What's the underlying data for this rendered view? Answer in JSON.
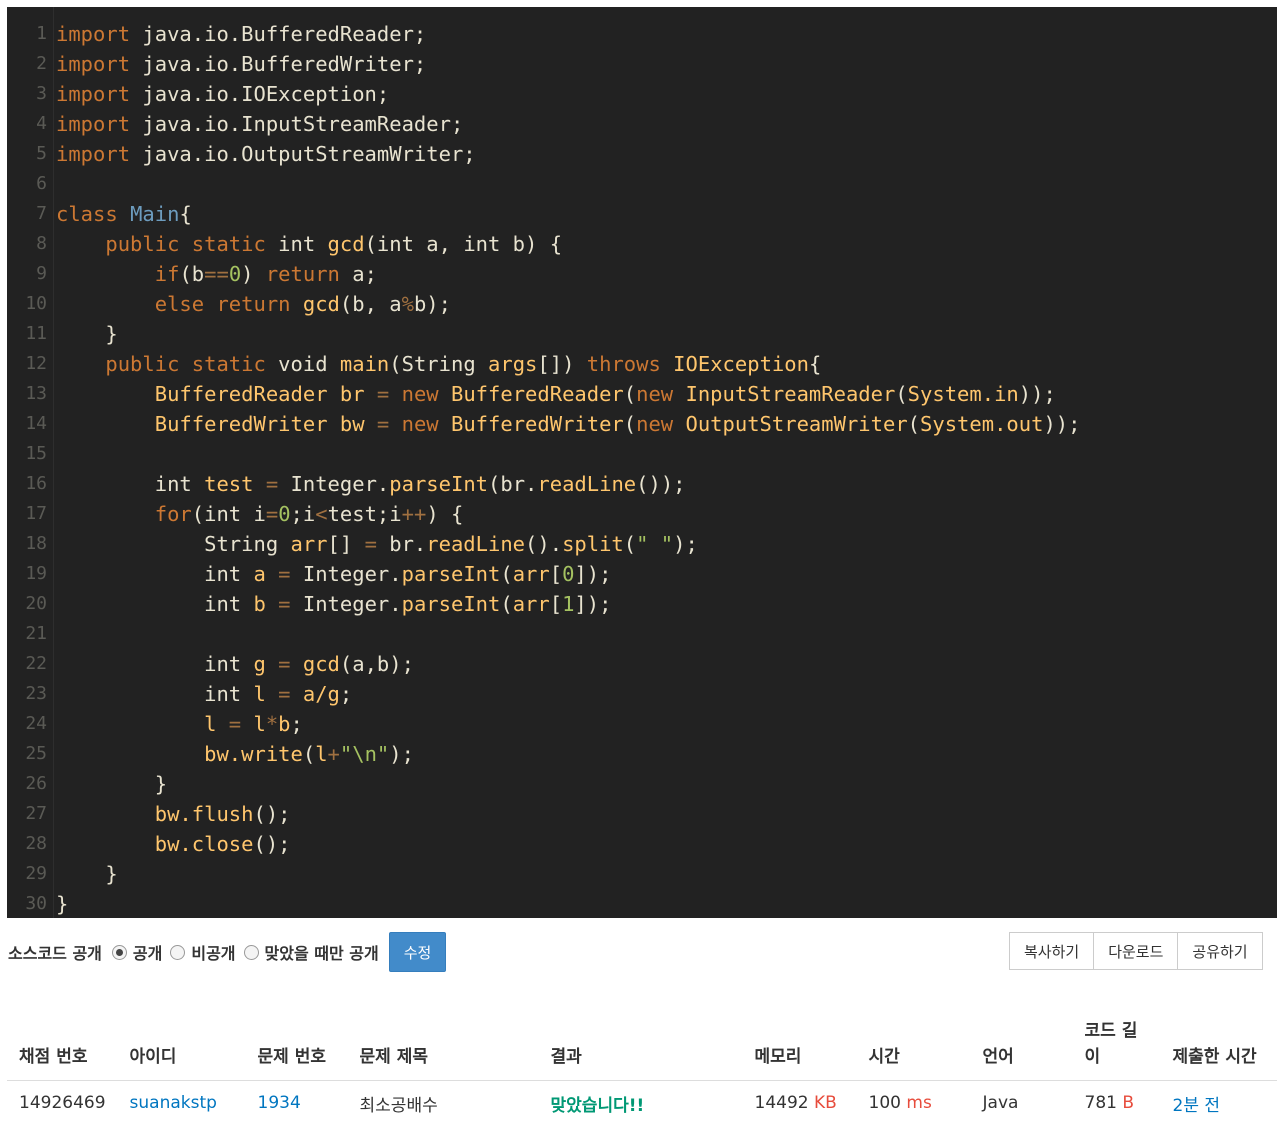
{
  "code": {
    "lines": [
      [
        [
          "kw",
          "import"
        ],
        [
          "plain",
          " java.io.BufferedReader;"
        ]
      ],
      [
        [
          "kw",
          "import"
        ],
        [
          "plain",
          " java.io.BufferedWriter;"
        ]
      ],
      [
        [
          "kw",
          "import"
        ],
        [
          "plain",
          " java.io.IOException;"
        ]
      ],
      [
        [
          "kw",
          "import"
        ],
        [
          "plain",
          " java.io.InputStreamReader;"
        ]
      ],
      [
        [
          "kw",
          "import"
        ],
        [
          "plain",
          " java.io.OutputStreamWriter;"
        ]
      ],
      [],
      [
        [
          "kw",
          "class"
        ],
        [
          "plain",
          " "
        ],
        [
          "cls",
          "Main"
        ],
        [
          "plain",
          "{"
        ]
      ],
      [
        [
          "plain",
          "    "
        ],
        [
          "kw",
          "public static"
        ],
        [
          "plain",
          " int "
        ],
        [
          "fn",
          "gcd"
        ],
        [
          "plain",
          "(int a, int b) {"
        ]
      ],
      [
        [
          "plain",
          "        "
        ],
        [
          "kw",
          "if"
        ],
        [
          "plain",
          "(b"
        ],
        [
          "op",
          "=="
        ],
        [
          "num",
          "0"
        ],
        [
          "plain",
          ") "
        ],
        [
          "kw",
          "return"
        ],
        [
          "plain",
          " a;"
        ]
      ],
      [
        [
          "plain",
          "        "
        ],
        [
          "kw",
          "else return"
        ],
        [
          "plain",
          " "
        ],
        [
          "fn",
          "gcd"
        ],
        [
          "plain",
          "(b, a"
        ],
        [
          "op",
          "%"
        ],
        [
          "plain",
          "b);"
        ]
      ],
      [
        [
          "plain",
          "    }"
        ]
      ],
      [
        [
          "plain",
          "    "
        ],
        [
          "kw",
          "public static"
        ],
        [
          "plain",
          " void "
        ],
        [
          "fn",
          "main"
        ],
        [
          "plain",
          "(String "
        ],
        [
          "fn",
          "args"
        ],
        [
          "plain",
          "[]) "
        ],
        [
          "kw",
          "throws"
        ],
        [
          "plain",
          " "
        ],
        [
          "fn",
          "IOException"
        ],
        [
          "plain",
          "{"
        ]
      ],
      [
        [
          "plain",
          "        "
        ],
        [
          "fn",
          "BufferedReader br"
        ],
        [
          "plain",
          " "
        ],
        [
          "op",
          "="
        ],
        [
          "plain",
          " "
        ],
        [
          "kw",
          "new"
        ],
        [
          "plain",
          " "
        ],
        [
          "fn",
          "BufferedReader"
        ],
        [
          "plain",
          "("
        ],
        [
          "kw",
          "new"
        ],
        [
          "plain",
          " "
        ],
        [
          "fn",
          "InputStreamReader"
        ],
        [
          "plain",
          "("
        ],
        [
          "fn",
          "System.in"
        ],
        [
          "plain",
          "));"
        ]
      ],
      [
        [
          "plain",
          "        "
        ],
        [
          "fn",
          "BufferedWriter bw"
        ],
        [
          "plain",
          " "
        ],
        [
          "op",
          "="
        ],
        [
          "plain",
          " "
        ],
        [
          "kw",
          "new"
        ],
        [
          "plain",
          " "
        ],
        [
          "fn",
          "BufferedWriter"
        ],
        [
          "plain",
          "("
        ],
        [
          "kw",
          "new"
        ],
        [
          "plain",
          " "
        ],
        [
          "fn",
          "OutputStreamWriter"
        ],
        [
          "plain",
          "("
        ],
        [
          "fn",
          "System.out"
        ],
        [
          "plain",
          "));"
        ]
      ],
      [],
      [
        [
          "plain",
          "        int "
        ],
        [
          "fn",
          "test"
        ],
        [
          "plain",
          " "
        ],
        [
          "op",
          "="
        ],
        [
          "plain",
          " Integer."
        ],
        [
          "fn",
          "parseInt"
        ],
        [
          "plain",
          "(br."
        ],
        [
          "fn",
          "readLine"
        ],
        [
          "plain",
          "());"
        ]
      ],
      [
        [
          "plain",
          "        "
        ],
        [
          "kw",
          "for"
        ],
        [
          "plain",
          "(int i"
        ],
        [
          "op",
          "="
        ],
        [
          "num",
          "0"
        ],
        [
          "plain",
          ";i"
        ],
        [
          "op",
          "<"
        ],
        [
          "plain",
          "test;i"
        ],
        [
          "op",
          "++"
        ],
        [
          "plain",
          ") {"
        ]
      ],
      [
        [
          "plain",
          "            String "
        ],
        [
          "fn",
          "arr"
        ],
        [
          "plain",
          "[] "
        ],
        [
          "op",
          "="
        ],
        [
          "plain",
          " br."
        ],
        [
          "fn",
          "readLine"
        ],
        [
          "plain",
          "()."
        ],
        [
          "fn",
          "split"
        ],
        [
          "plain",
          "("
        ],
        [
          "str",
          "\" \""
        ],
        [
          "plain",
          ");"
        ]
      ],
      [
        [
          "plain",
          "            int "
        ],
        [
          "fn",
          "a"
        ],
        [
          "plain",
          " "
        ],
        [
          "op",
          "="
        ],
        [
          "plain",
          " Integer."
        ],
        [
          "fn",
          "parseInt"
        ],
        [
          "plain",
          "("
        ],
        [
          "fn",
          "arr"
        ],
        [
          "plain",
          "["
        ],
        [
          "num",
          "0"
        ],
        [
          "plain",
          "]);"
        ]
      ],
      [
        [
          "plain",
          "            int "
        ],
        [
          "fn",
          "b"
        ],
        [
          "plain",
          " "
        ],
        [
          "op",
          "="
        ],
        [
          "plain",
          " Integer."
        ],
        [
          "fn",
          "parseInt"
        ],
        [
          "plain",
          "("
        ],
        [
          "fn",
          "arr"
        ],
        [
          "plain",
          "["
        ],
        [
          "num",
          "1"
        ],
        [
          "plain",
          "]);"
        ]
      ],
      [],
      [
        [
          "plain",
          "            int "
        ],
        [
          "fn",
          "g"
        ],
        [
          "plain",
          " "
        ],
        [
          "op",
          "="
        ],
        [
          "plain",
          " "
        ],
        [
          "fn",
          "gcd"
        ],
        [
          "plain",
          "(a,b);"
        ]
      ],
      [
        [
          "plain",
          "            int "
        ],
        [
          "fn",
          "l"
        ],
        [
          "plain",
          " "
        ],
        [
          "op",
          "="
        ],
        [
          "plain",
          " "
        ],
        [
          "fn",
          "a/g"
        ],
        [
          "plain",
          ";"
        ]
      ],
      [
        [
          "plain",
          "            "
        ],
        [
          "fn",
          "l"
        ],
        [
          "plain",
          " "
        ],
        [
          "op",
          "="
        ],
        [
          "plain",
          " "
        ],
        [
          "fn",
          "l"
        ],
        [
          "op",
          "*"
        ],
        [
          "fn",
          "b"
        ],
        [
          "plain",
          ";"
        ]
      ],
      [
        [
          "plain",
          "            "
        ],
        [
          "fn",
          "bw.write"
        ],
        [
          "plain",
          "("
        ],
        [
          "fn",
          "l"
        ],
        [
          "op",
          "+"
        ],
        [
          "str",
          "\"\\n\""
        ],
        [
          "plain",
          ");"
        ]
      ],
      [
        [
          "plain",
          "        }"
        ]
      ],
      [
        [
          "plain",
          "        "
        ],
        [
          "fn",
          "bw.flush"
        ],
        [
          "plain",
          "();"
        ]
      ],
      [
        [
          "plain",
          "        "
        ],
        [
          "fn",
          "bw.close"
        ],
        [
          "plain",
          "();"
        ]
      ],
      [
        [
          "plain",
          "    }"
        ]
      ],
      [
        [
          "plain",
          "}"
        ]
      ]
    ]
  },
  "visibility": {
    "label": "소스코드 공개",
    "options": [
      {
        "label": "공개",
        "checked": true
      },
      {
        "label": "비공개",
        "checked": false
      },
      {
        "label": "맞았을 때만 공개",
        "checked": false
      }
    ],
    "edit_label": "수정"
  },
  "actions": {
    "copy_label": "복사하기",
    "download_label": "다운로드",
    "share_label": "공유하기"
  },
  "table": {
    "headers": [
      "채점 번호",
      "아이디",
      "문제 번호",
      "문제 제목",
      "결과",
      "메모리",
      "시간",
      "언어",
      "코드 길\n이",
      "제출한 시간"
    ],
    "row": {
      "submission_id": "14926469",
      "user_id": "suanakstp",
      "problem_id": "1934",
      "problem_title": "최소공배수",
      "result": "맞았습니다!!",
      "memory_value": "14492",
      "memory_unit": "KB",
      "time_value": "100",
      "time_unit": "ms",
      "language": "Java",
      "code_length_value": "781",
      "code_length_unit": "B",
      "submitted_at": "2분 전"
    }
  },
  "colors": {
    "editor_bg": "#222222",
    "keyword": "#cc7833",
    "function": "#ffc66d",
    "number": "#a5c261",
    "accent_button": "#428bca",
    "link": "#0076c0",
    "result_ok": "#009874",
    "unit": "#e74c3c"
  }
}
